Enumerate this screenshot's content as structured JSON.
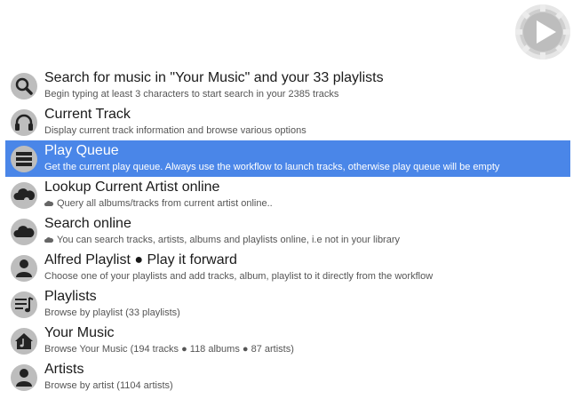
{
  "search": {
    "value": "",
    "placeholder": ""
  },
  "brand_color": "#4a86e8",
  "results": [
    {
      "title": "Search for music in \"Your Music\" and your 33 playlists",
      "subtitle": "Begin typing at least 3 characters to start search in your 2385 tracks",
      "icon": "search-icon",
      "selected": false
    },
    {
      "title": "Current Track",
      "subtitle": "Display current track information and browse various options",
      "icon": "headphones-icon",
      "selected": false
    },
    {
      "title": "Play Queue",
      "subtitle": "Get the current play queue. Always use the workflow to launch tracks, otherwise play queue will be empty",
      "icon": "queue-icon",
      "selected": true
    },
    {
      "title": "Lookup Current Artist online",
      "subtitle": "Query all albums/tracks from current artist online..",
      "icon": "artist-cloud-icon",
      "selected": false
    },
    {
      "title": "Search online",
      "subtitle": "You can search tracks, artists, albums and playlists online, i.e not in your library",
      "icon": "cloud-icon",
      "selected": false
    },
    {
      "title": "Alfred Playlist ● Play it forward",
      "subtitle": "Choose one of your playlists and add tracks, album, playlist to it directly from the workflow",
      "icon": "alfred-playlist-icon",
      "selected": false
    },
    {
      "title": "Playlists",
      "subtitle": "Browse by playlist (33 playlists)",
      "icon": "playlist-icon",
      "selected": false
    },
    {
      "title": "Your Music",
      "subtitle": "Browse Your Music (194 tracks ● 118  albums ● 87 artists)",
      "icon": "home-music-icon",
      "selected": false
    },
    {
      "title": "Artists",
      "subtitle": "Browse by artist (1104 artists)",
      "icon": "artist-icon",
      "selected": false
    }
  ]
}
